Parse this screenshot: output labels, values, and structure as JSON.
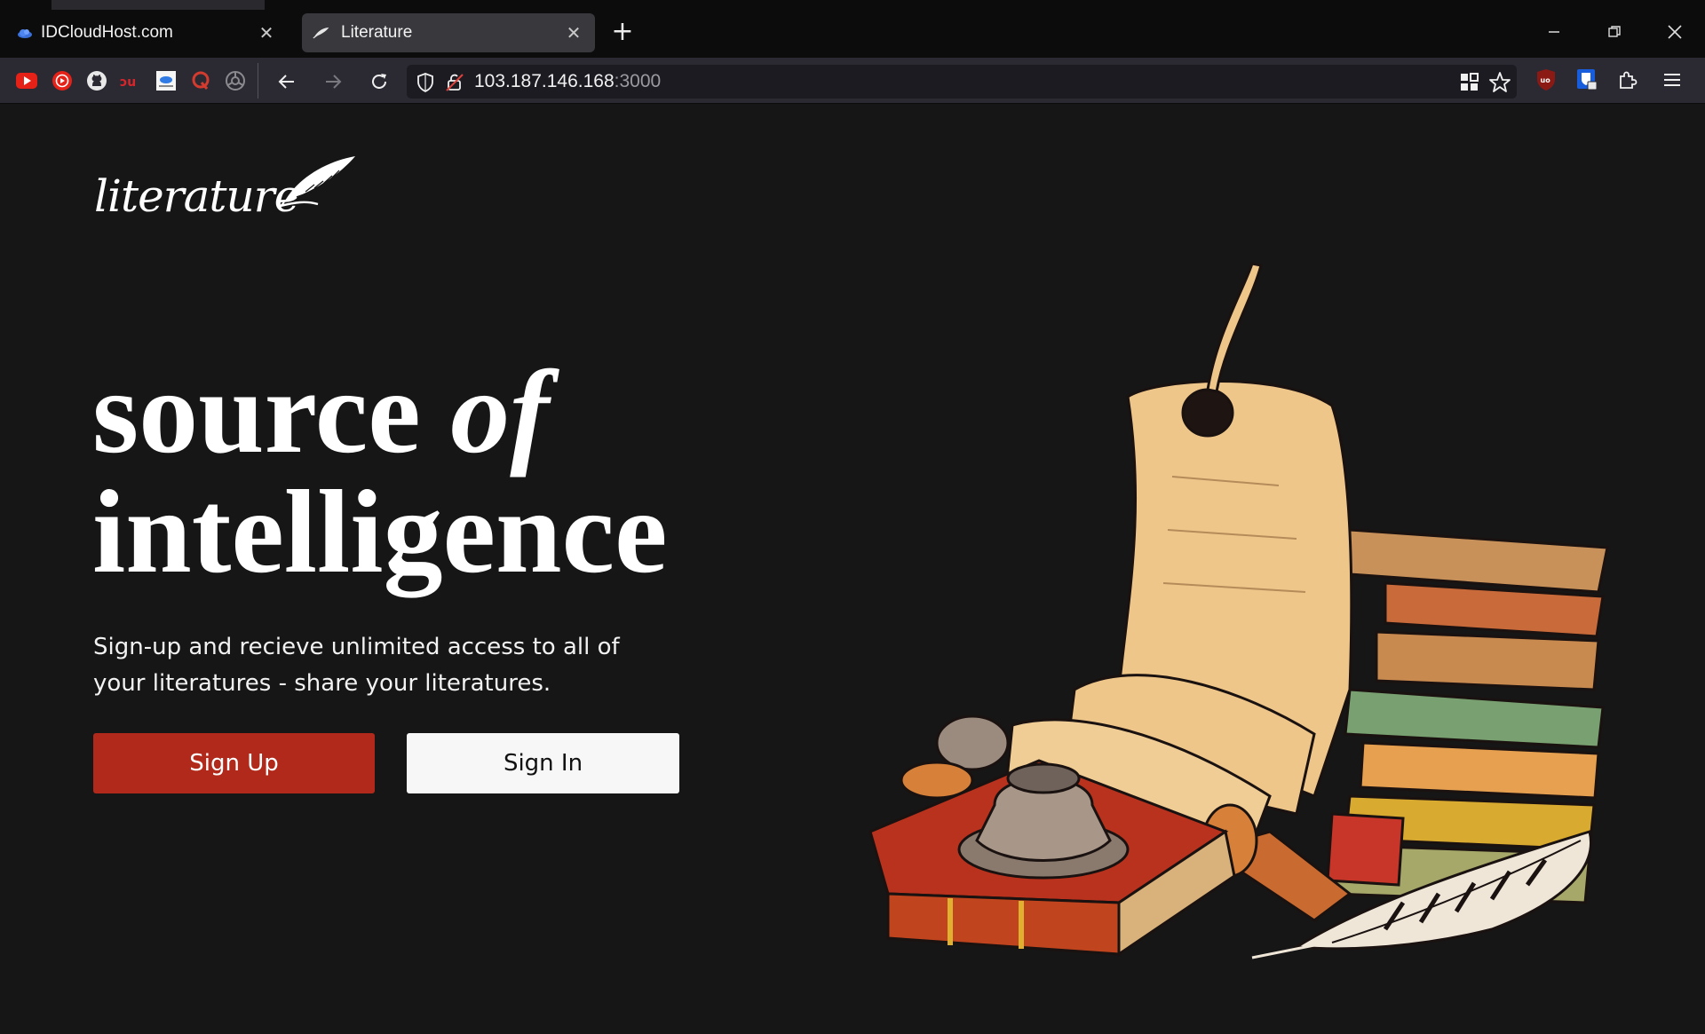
{
  "browser": {
    "tabs": [
      {
        "title": "IDCloudHost.com",
        "icon": "cloud-favicon-icon",
        "active": false
      },
      {
        "title": "Literature",
        "icon": "quill-favicon-icon",
        "active": true
      }
    ],
    "new_tab_label": "+",
    "close_label": "✕",
    "bookmarks": [
      "youtube-icon",
      "youtube-music-icon",
      "github-icon",
      "duolingo-icon",
      "idcloudhost-icon",
      "quora-icon",
      "chromium-icon"
    ],
    "url": {
      "host": "103.187.146.168",
      "port": ":3000"
    },
    "colors": {
      "tabstrip": "#0c0c0d",
      "toolbar": "#2b2a33",
      "urlbar": "#1c1b22"
    }
  },
  "page": {
    "logo_text": "literature",
    "headline": {
      "word1": "source",
      "word2": "of",
      "word3": "intelligence"
    },
    "subtext": "Sign-up and recieve unlimited access to all of your literatures - share your literatures.",
    "buttons": {
      "signup": "Sign Up",
      "signin": "Sign In"
    },
    "illustration": "books-scroll-inkwell-quill-illustration",
    "colors": {
      "background": "#161616",
      "signup": "#b0291b",
      "signin": "#f7f7f7"
    }
  }
}
